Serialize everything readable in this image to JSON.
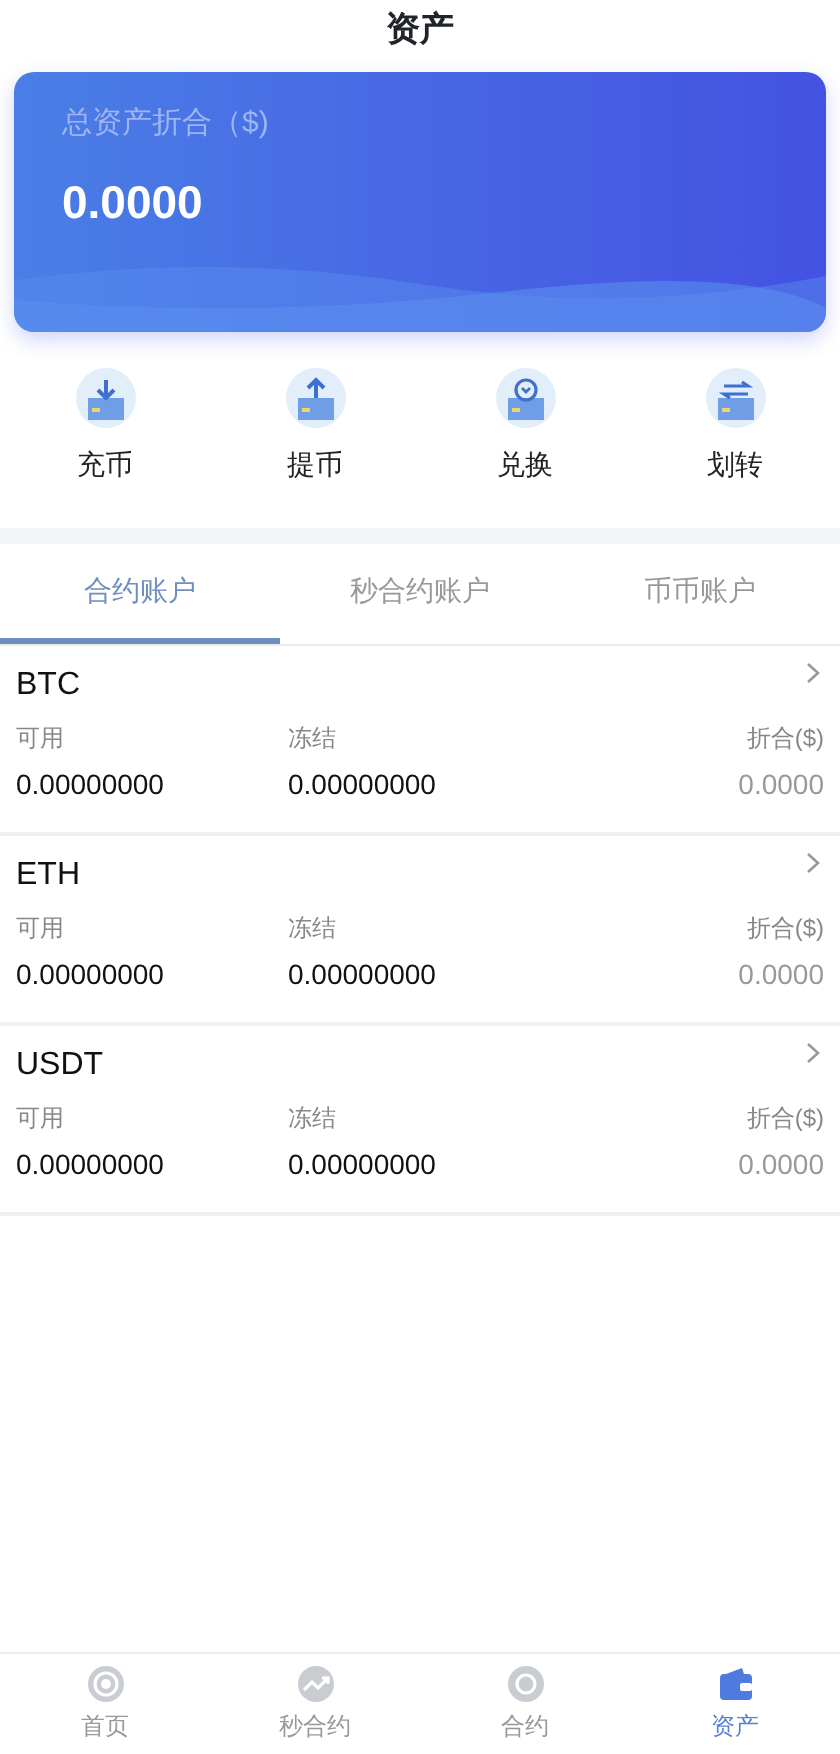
{
  "header": {
    "title": "资产"
  },
  "summary": {
    "label": "总资产折合（$)",
    "value": "0.0000"
  },
  "actions": [
    {
      "kind": "deposit",
      "label": "充币"
    },
    {
      "kind": "withdraw",
      "label": "提币"
    },
    {
      "kind": "exchange",
      "label": "兑换"
    },
    {
      "kind": "transfer",
      "label": "划转"
    }
  ],
  "tabs": [
    {
      "label": "合约账户",
      "selected": true
    },
    {
      "label": "秒合约账户",
      "selected": false
    },
    {
      "label": "币币账户",
      "selected": false
    }
  ],
  "accounts": [
    {
      "coin": "BTC",
      "available_label": "可用",
      "frozen_label": "冻结",
      "value_label": "折合($)",
      "available": "0.00000000",
      "frozen": "0.00000000",
      "value": "0.0000"
    },
    {
      "coin": "ETH",
      "available_label": "可用",
      "frozen_label": "冻结",
      "value_label": "折合($)",
      "available": "0.00000000",
      "frozen": "0.00000000",
      "value": "0.0000"
    },
    {
      "coin": "USDT",
      "available_label": "可用",
      "frozen_label": "冻结",
      "value_label": "折合($)",
      "available": "0.00000000",
      "frozen": "0.00000000",
      "value": "0.0000"
    }
  ],
  "bottom_nav": [
    {
      "kind": "home",
      "label": "首页",
      "selected": false
    },
    {
      "kind": "trend",
      "label": "秒合约",
      "selected": false
    },
    {
      "kind": "contract",
      "label": "合约",
      "selected": false
    },
    {
      "kind": "wallet",
      "label": "资产",
      "selected": true
    }
  ]
}
